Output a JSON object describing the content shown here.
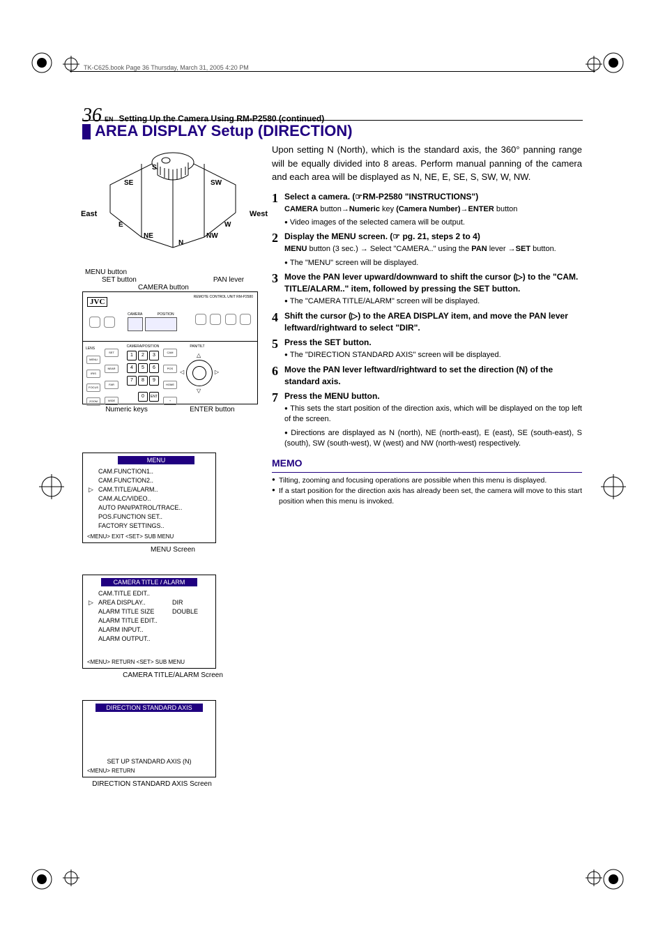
{
  "runner": "TK-C625.book  Page 36  Thursday, March 31, 2005  4:20 PM",
  "page_number": "36",
  "page_lang": "EN",
  "section": "Setting Up the Camera Using RM-P2580 (continued)",
  "heading": "AREA DISPLAY Setup (DIRECTION)",
  "compass": {
    "east": "East",
    "west": "West",
    "n": "N",
    "ne": "NE",
    "nw": "NW",
    "s": "S",
    "se": "SE",
    "sw": "SW",
    "e": "E",
    "w": "W"
  },
  "ctrl_labels": {
    "menu_button": "MENU button",
    "set_button": "SET button",
    "camera_button": "CAMERA button",
    "pan_lever": "PAN lever",
    "numeric_keys": "Numeric keys",
    "enter_button": "ENTER button",
    "jvc": "JVC",
    "remote": "REMOTE CONTROL UNIT RM-P2580",
    "section_lens": "LENS",
    "section_campos": "CAMERA/POSITION",
    "section_pantilt": "PAN/TILT",
    "camera": "CAMERA",
    "position": "POSITION"
  },
  "keys": [
    "1",
    "2",
    "3",
    "4",
    "5",
    "6",
    "7",
    "8",
    "9",
    "0"
  ],
  "menu1": {
    "title": "MENU",
    "items": [
      "CAM.FUNCTION1..",
      "CAM.FUNCTION2..",
      "CAM.TITLE/ALARM..",
      "CAM.ALC/VIDEO..",
      "AUTO PAN/PATROL/TRACE..",
      "POS.FUNCTION SET..",
      "FACTORY SETTINGS.."
    ],
    "cursor_index": 2,
    "footer": "<MENU> EXIT  <SET> SUB  MENU",
    "caption": "MENU Screen"
  },
  "menu2": {
    "title": "CAMERA  TITLE / ALARM",
    "items": [
      {
        "l": "CAM.TITLE EDIT..",
        "v": ""
      },
      {
        "l": "AREA DISPLAY..",
        "v": "DIR"
      },
      {
        "l": "ALARM TITLE SIZE",
        "v": "DOUBLE"
      },
      {
        "l": "ALARM TITLE  EDIT..",
        "v": ""
      },
      {
        "l": "ALARM  INPUT..",
        "v": ""
      },
      {
        "l": "ALARM  OUTPUT..",
        "v": ""
      }
    ],
    "cursor_index": 1,
    "footer": "<MENU> RETURN  <SET> SUB  MENU",
    "caption": "CAMERA TITLE/ALARM Screen"
  },
  "menu3": {
    "title": "DIRECTION  STANDARD  AXIS",
    "line": "SET  UP  STANDARD  AXIS (N)",
    "footer": "<MENU> RETURN",
    "caption": "DIRECTION STANDARD AXIS Screen"
  },
  "intro": "Upon setting N (North), which is the standard axis, the 360° panning range will be equally divided into 8 areas. Perform manual panning of the camera and each area will be displayed as N, NE, E, SE, S, SW, W, NW.",
  "steps": {
    "s1": {
      "head_a": "Select a camera. (☞",
      "head_b": "RM-P2580",
      "head_c": " \"",
      "head_d": "INSTRUCTIONS",
      "head_e": "\")",
      "line_a": "CAMERA",
      "line_b": " button→",
      "line_c": "Numeric",
      "line_d": " key ",
      "line_e": "(Camera Number)",
      "line_f": "→",
      "line_g": "ENTER",
      "line_h": " button",
      "bullet": "Video images of the selected camera will be output."
    },
    "s2": {
      "head": "Display the MENU screen. (☞ pg. 21, steps 2 to 4)",
      "line_a": "MENU",
      "line_b": " button (3 sec.) → Select \"CAMERA..\" using the ",
      "line_c": "PAN",
      "line_d": " lever →",
      "line_e": "SET",
      "line_f": " button.",
      "bullet": "The \"MENU\" screen will be displayed."
    },
    "s3": {
      "head": "Move the PAN lever upward/downward to shift the cursor (▷) to the \"CAM. TITLE/ALARM..\" item, followed by pressing the SET button.",
      "bullet": "The \"CAMERA TITLE/ALARM\" screen will be displayed."
    },
    "s4": {
      "head": "Shift the cursor (▷) to the AREA DISPLAY item, and move the PAN lever leftward/rightward to select \"DIR\"."
    },
    "s5": {
      "head": "Press the SET button.",
      "bullet": "The \"DIRECTION STANDARD AXIS\" screen will be displayed."
    },
    "s6": {
      "head": "Move the PAN lever leftward/rightward to set the direction (N) of the standard axis."
    },
    "s7": {
      "head": "Press the MENU button.",
      "bullet1": "This sets the start position of the direction axis, which will be displayed on the top left of the screen.",
      "bullet2": "Directions are displayed as N (north), NE (north-east), E (east), SE (south-east), S (south), SW (south-west), W (west) and NW (north-west) respectively."
    }
  },
  "memo": {
    "title": "MEMO",
    "m1": "Tilting, zooming and focusing operations are possible when this menu is displayed.",
    "m2": "If a start position for the direction axis has already been set, the camera will move to this start position when this menu is invoked."
  }
}
